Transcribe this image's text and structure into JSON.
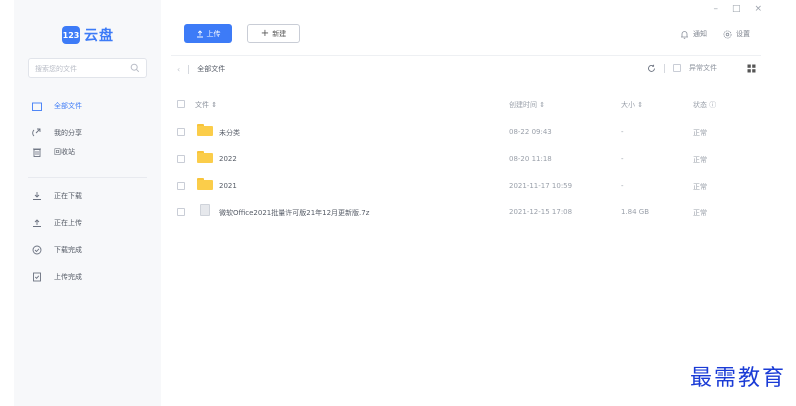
{
  "app": {
    "logo_badge": "123",
    "logo_text": "云盘",
    "brand_color": "#3d7bf7"
  },
  "window_controls": {
    "minimize": "–",
    "maximize": "□",
    "close": "×"
  },
  "sidebar": {
    "search": {
      "placeholder": "搜索您的文件"
    },
    "items": [
      {
        "label": "全部文件",
        "icon": "folder-outline-icon",
        "active": true
      },
      {
        "label": "我的分享",
        "icon": "share-icon",
        "active": false
      },
      {
        "label": "回收站",
        "icon": "trash-icon",
        "active": false
      },
      {
        "label": "正在下载",
        "icon": "download-icon",
        "active": false
      },
      {
        "label": "正在上传",
        "icon": "upload-icon",
        "active": false
      },
      {
        "label": "下载完成",
        "icon": "check-circle-icon",
        "active": false
      },
      {
        "label": "上传完成",
        "icon": "file-check-icon",
        "active": false
      }
    ]
  },
  "toolbar": {
    "upload_label": "上传",
    "new_label": "新建",
    "notify_label": "通知",
    "settings_label": "设置"
  },
  "breadcrumb": {
    "current": "全部文件"
  },
  "filters": {
    "abnormal_label": "异常文件"
  },
  "table": {
    "columns": {
      "name": "文件 ⇕",
      "created": "创建时间 ⇕",
      "size": "大小 ⇕",
      "status": "状态 ⓘ"
    },
    "rows": [
      {
        "type": "folder",
        "name": "未分类",
        "created": "08-22 09:43",
        "size": "-",
        "status": "正常"
      },
      {
        "type": "folder",
        "name": "2022",
        "created": "08-20 11:18",
        "size": "-",
        "status": "正常"
      },
      {
        "type": "folder",
        "name": "2021",
        "created": "2021-11-17 10:59",
        "size": "-",
        "status": "正常"
      },
      {
        "type": "file",
        "name": "微软Office2021批量许可版21年12月更新版.7z",
        "created": "2021-12-15 17:08",
        "size": "1.84 GB",
        "status": "正常"
      }
    ]
  },
  "watermark": "最需教育"
}
